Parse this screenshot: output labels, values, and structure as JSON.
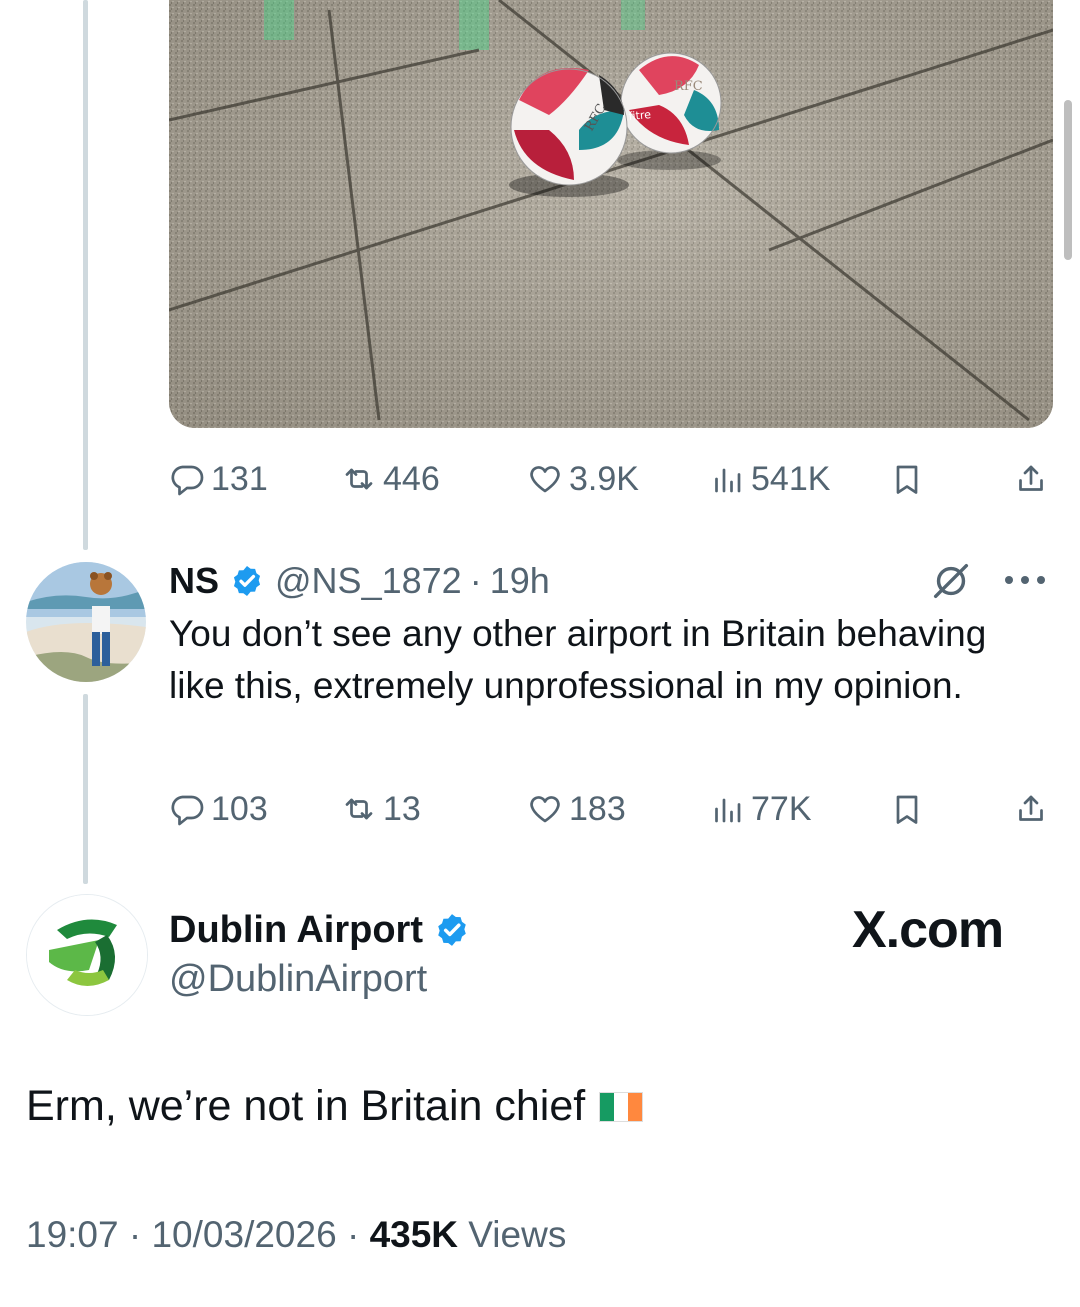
{
  "colors": {
    "accent": "#1d9bf0",
    "muted": "#536471",
    "text": "#0f1419",
    "thread": "#cfd9de"
  },
  "media_tweet": {
    "image_text": {
      "ball_a": "RFC",
      "ball_b": "RFC",
      "ball_brand": "fitre"
    },
    "actions": {
      "replies": "131",
      "reposts": "446",
      "likes": "3.9K",
      "views": "541K"
    }
  },
  "reply": {
    "display_name": "NS",
    "handle": "@NS_1872",
    "separator": "·",
    "time": "19h",
    "text": "You don’t see any other airport in Britain behaving like this, extremely unprofessional in my opinion.",
    "actions": {
      "replies": "103",
      "reposts": "13",
      "likes": "183",
      "views": "77K"
    }
  },
  "main_tweet": {
    "display_name": "Dublin Airport",
    "handle": "@DublinAirport",
    "text": "Erm, we’re not in Britain chief",
    "time": "19:07",
    "date": "10/03/2026",
    "views_count": "435K",
    "views_label": "Views",
    "separator": "·"
  },
  "watermark": "X.com",
  "icons": [
    "reply-icon",
    "repost-icon",
    "like-icon",
    "views-icon",
    "bookmark-icon",
    "share-icon",
    "verified-icon",
    "grok-icon",
    "more-icon",
    "ireland-flag"
  ]
}
